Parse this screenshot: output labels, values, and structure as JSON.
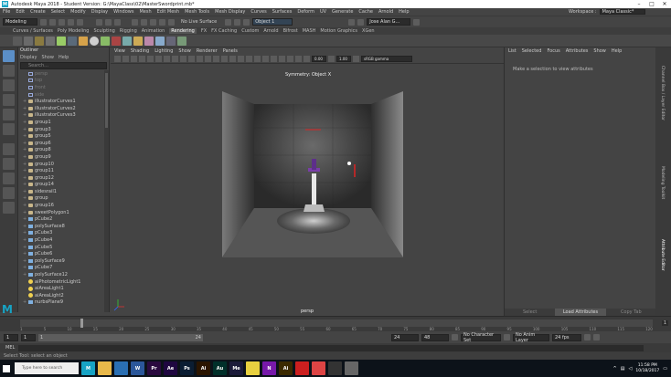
{
  "window": {
    "title": "Autodesk Maya 2018 - Student Version: G:\\MayaClass\\02\\MasterSwordprint.mb*"
  },
  "menus": [
    "File",
    "Edit",
    "Create",
    "Select",
    "Modify",
    "Display",
    "Windows",
    "Mesh",
    "Edit Mesh",
    "Mesh Tools",
    "Mesh Display",
    "Curves",
    "Surfaces",
    "Deform",
    "UV",
    "Generate",
    "Cache",
    "Arnold",
    "Help"
  ],
  "workspace": {
    "label": "Workspace :",
    "value": "Maya Classic*"
  },
  "status_line": {
    "mode": "Modeling",
    "live": "No Live Surface",
    "object": "Object 1",
    "user": "Jose Alan G..."
  },
  "shelf_tabs": [
    "Curves / Surfaces",
    "Poly Modeling",
    "Sculpting",
    "Rigging",
    "Animation",
    "Rendering",
    "FX",
    "FX Caching",
    "Custom",
    "Arnold",
    "Bifrost",
    "MASH",
    "Motion Graphics",
    "XGen"
  ],
  "shelf_active": "Rendering",
  "outliner": {
    "title": "Outliner",
    "menu": [
      "Display",
      "Show",
      "Help"
    ],
    "search_placeholder": "Search...",
    "items": [
      {
        "label": "persp",
        "type": "cam",
        "dim": true
      },
      {
        "label": "top",
        "type": "cam",
        "dim": true
      },
      {
        "label": "front",
        "type": "cam",
        "dim": true
      },
      {
        "label": "side",
        "type": "cam",
        "dim": true
      },
      {
        "label": "illustratorCurves1",
        "type": "grp"
      },
      {
        "label": "illustratorCurves2",
        "type": "grp"
      },
      {
        "label": "illustratorCurves3",
        "type": "grp"
      },
      {
        "label": "group1",
        "type": "grp"
      },
      {
        "label": "group3",
        "type": "grp"
      },
      {
        "label": "group5",
        "type": "grp"
      },
      {
        "label": "group6",
        "type": "grp"
      },
      {
        "label": "group8",
        "type": "grp"
      },
      {
        "label": "group9",
        "type": "grp"
      },
      {
        "label": "group10",
        "type": "grp"
      },
      {
        "label": "group11",
        "type": "grp"
      },
      {
        "label": "group12",
        "type": "grp"
      },
      {
        "label": "group14",
        "type": "grp"
      },
      {
        "label": "sidesrail1",
        "type": "grp"
      },
      {
        "label": "group",
        "type": "grp"
      },
      {
        "label": "group16",
        "type": "grp"
      },
      {
        "label": "sweetPolygon1",
        "type": "grp"
      },
      {
        "label": "pCube2",
        "type": "poly"
      },
      {
        "label": "polySurface8",
        "type": "poly"
      },
      {
        "label": "pCube3",
        "type": "poly"
      },
      {
        "label": "pCube4",
        "type": "poly"
      },
      {
        "label": "pCube5",
        "type": "poly"
      },
      {
        "label": "pCube6",
        "type": "poly"
      },
      {
        "label": "polySurface9",
        "type": "poly"
      },
      {
        "label": "pCube7",
        "type": "poly"
      },
      {
        "label": "polySurface12",
        "type": "poly"
      },
      {
        "label": "aiPhotometricLight1",
        "type": "light"
      },
      {
        "label": "aiAreaLight1",
        "type": "light"
      },
      {
        "label": "aiAreaLight2",
        "type": "light"
      },
      {
        "label": "nurbsPlane9",
        "type": "poly"
      }
    ]
  },
  "viewport": {
    "menu": [
      "View",
      "Shading",
      "Lighting",
      "Show",
      "Renderer",
      "Panels"
    ],
    "symmetry": "Symmetry: Object X",
    "camera": "persp",
    "gamma": "sRGB gamma",
    "exposure": "0.00",
    "gamma_val": "1.00"
  },
  "attr_panel": {
    "menu": [
      "List",
      "Selected",
      "Focus",
      "Attributes",
      "Show",
      "Help"
    ],
    "message": "Make a selection to view attributes",
    "buttons": [
      "Select",
      "Load Attributes",
      "Copy Tab"
    ],
    "side_tabs": [
      "Channel Box / Layer Editor",
      "Modeling Toolkit",
      "Attribute Editor"
    ]
  },
  "timeline": {
    "ticks": [
      "1",
      "5",
      "10",
      "15",
      "20",
      "25",
      "30",
      "35",
      "40",
      "45",
      "50",
      "55",
      "60",
      "65",
      "70",
      "75",
      "80",
      "85",
      "90",
      "95",
      "100",
      "105",
      "110",
      "115",
      "120"
    ],
    "current": "1"
  },
  "range": {
    "start": "1",
    "start2": "1",
    "inner_start": "1",
    "inner_end": "24",
    "end": "24",
    "end2": "48",
    "character": "No Character Set",
    "anim_layer": "No Anim Layer",
    "fps": "24 fps"
  },
  "mel": {
    "label": "MEL"
  },
  "help_line": "Select Tool: select an object",
  "taskbar": {
    "search": "Type here to search",
    "apps": [
      {
        "name": "maya",
        "label": "M",
        "color": "#17a3c4"
      },
      {
        "name": "file-explorer",
        "label": "",
        "color": "#e8b84a"
      },
      {
        "name": "store",
        "label": "",
        "color": "#2a6fb3"
      },
      {
        "name": "word",
        "label": "W",
        "color": "#2b579a"
      },
      {
        "name": "premiere",
        "label": "Pr",
        "color": "#2a0a3f"
      },
      {
        "name": "after-effects",
        "label": "Ae",
        "color": "#1f0740"
      },
      {
        "name": "photoshop",
        "label": "Ps",
        "color": "#0b1d33"
      },
      {
        "name": "illustrator",
        "label": "Ai",
        "color": "#2b1500"
      },
      {
        "name": "audition",
        "label": "Au",
        "color": "#00302a"
      },
      {
        "name": "media-encoder",
        "label": "Me",
        "color": "#1b1b3a"
      },
      {
        "name": "paint",
        "label": "",
        "color": "#e8d040"
      },
      {
        "name": "onenote",
        "label": "N",
        "color": "#7719aa"
      },
      {
        "name": "illustrator2",
        "label": "Ai",
        "color": "#3b2a00"
      },
      {
        "name": "adobe",
        "label": "",
        "color": "#cc1f1f"
      },
      {
        "name": "chrome",
        "label": "",
        "color": "#d44"
      },
      {
        "name": "unity",
        "label": "",
        "color": "#333"
      },
      {
        "name": "other",
        "label": "",
        "color": "#666"
      }
    ],
    "time": "11:58 PM",
    "date": "10/18/2017"
  }
}
